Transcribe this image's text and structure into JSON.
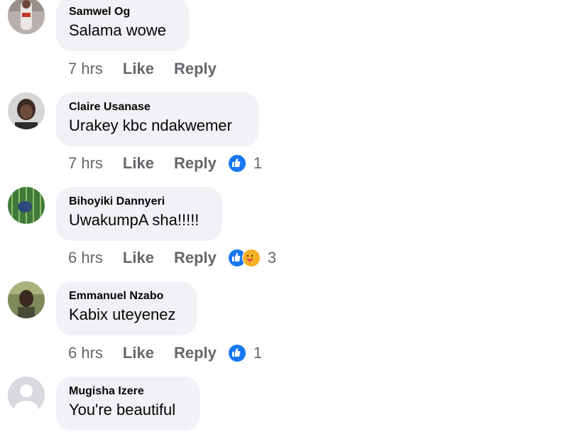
{
  "comments": [
    {
      "author": "Samwel Og",
      "text": "Salama wowe",
      "time": "7 hrs",
      "like_label": "Like",
      "reply_label": "Reply",
      "reaction_count": ""
    },
    {
      "author": "Claire Usanase",
      "text": "Urakey kbc ndakwemer",
      "time": "7 hrs",
      "like_label": "Like",
      "reply_label": "Reply",
      "reaction_count": "1"
    },
    {
      "author": "Bihoyiki Dannyeri",
      "text": "UwakumpA sha!!!!!",
      "time": "6 hrs",
      "like_label": "Like",
      "reply_label": "Reply",
      "reaction_count": "3"
    },
    {
      "author": "Emmanuel Nzabo",
      "text": "Kabix uteyenez",
      "time": "6 hrs",
      "like_label": "Like",
      "reply_label": "Reply",
      "reaction_count": "1"
    },
    {
      "author": "Mugisha Izere",
      "text": "You're beautiful",
      "time": "",
      "like_label": "",
      "reply_label": "",
      "reaction_count": ""
    }
  ],
  "colors": {
    "bubble": "#f0f2f5",
    "meta_text": "#65676b",
    "like_blue": "#1877f2",
    "care_yellow": "#f7b125"
  },
  "icons": [
    "avatar-photo",
    "like-reaction-icon",
    "care-reaction-icon",
    "default-avatar-icon"
  ]
}
